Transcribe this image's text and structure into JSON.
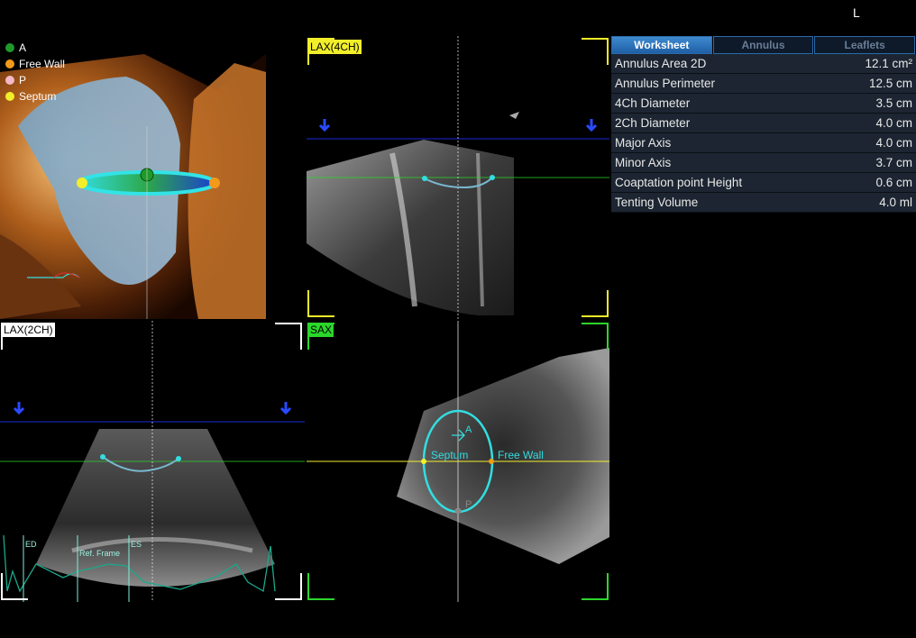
{
  "orientation_label": "L",
  "legend": [
    {
      "label": "A",
      "color": "#1f9a2a"
    },
    {
      "label": "Free Wall",
      "color": "#f39a1a"
    },
    {
      "label": "P",
      "color": "#f4b8c8"
    },
    {
      "label": "Septum",
      "color": "#f2ef2a"
    }
  ],
  "views": {
    "lax4": {
      "label": "LAX(4CH)",
      "color": "#f2ef2a"
    },
    "lax2": {
      "label": "LAX(2CH)",
      "color": "#ffffff"
    },
    "sax": {
      "label": "SAX",
      "color": "#2bd62b"
    }
  },
  "sax_labels": {
    "septum": "Septum",
    "free_wall": "Free Wall",
    "a": "A",
    "p": "P"
  },
  "ecg_labels": {
    "ed": "ED",
    "ref": "Ref. Frame",
    "es": "ES"
  },
  "worksheet": {
    "tabs": [
      "Worksheet",
      "Annulus",
      "Leaflets"
    ],
    "active_tab": "Worksheet",
    "rows": [
      {
        "label": "Annulus Area 2D",
        "value": "12.1 cm²"
      },
      {
        "label": "Annulus Perimeter",
        "value": "12.5 cm"
      },
      {
        "label": "4Ch Diameter",
        "value": "3.5 cm"
      },
      {
        "label": "2Ch Diameter",
        "value": "4.0 cm"
      },
      {
        "label": "Major Axis",
        "value": "4.0 cm"
      },
      {
        "label": "Minor Axis",
        "value": "3.7 cm"
      },
      {
        "label": "Coaptation point Height",
        "value": "0.6 cm"
      },
      {
        "label": "Tenting Volume",
        "value": "4.0 ml"
      }
    ]
  }
}
